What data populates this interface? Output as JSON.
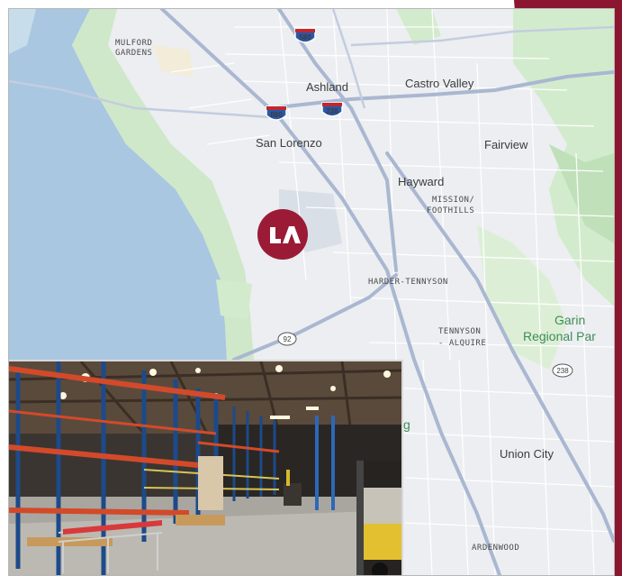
{
  "accent_color": "#8b1630",
  "map": {
    "places": [
      {
        "id": "mulford",
        "text": "MULFORD\nGARDENS",
        "style": "small"
      },
      {
        "id": "ashland",
        "text": "Ashland",
        "style": "town"
      },
      {
        "id": "castro-valley",
        "text": "Castro Valley",
        "style": "town"
      },
      {
        "id": "san-lorenzo",
        "text": "San Lorenzo",
        "style": "town"
      },
      {
        "id": "fairview",
        "text": "Fairview",
        "style": "town"
      },
      {
        "id": "hayward",
        "text": "Hayward",
        "style": "town"
      },
      {
        "id": "mission",
        "text": "MISSION/\nFOOTHILLS",
        "style": "small"
      },
      {
        "id": "harder",
        "text": "HARDER-TENNYSON",
        "style": "small"
      },
      {
        "id": "tennyson",
        "text": "TENNYSON\n- ALQUIRE",
        "style": "small"
      },
      {
        "id": "garin",
        "text": "Garin\nRegional Par",
        "style": "park"
      },
      {
        "id": "union-city",
        "text": "Union City",
        "style": "town"
      },
      {
        "id": "ardenwood",
        "text": "ARDENWOOD",
        "style": "small"
      }
    ],
    "shields": [
      {
        "id": "i580",
        "text": "580",
        "type": "interstate"
      },
      {
        "id": "i880",
        "text": "880",
        "type": "interstate"
      },
      {
        "id": "i238",
        "text": "238",
        "type": "interstate"
      },
      {
        "id": "ca92",
        "text": "92",
        "type": "state"
      },
      {
        "id": "ca238",
        "text": "238",
        "type": "state"
      }
    ],
    "marker": {
      "logo_text": "LA",
      "color": "#9b1b36"
    },
    "partial_label": "g"
  },
  "photo": {
    "subject": "warehouse interior with pallet racking and forklift"
  }
}
